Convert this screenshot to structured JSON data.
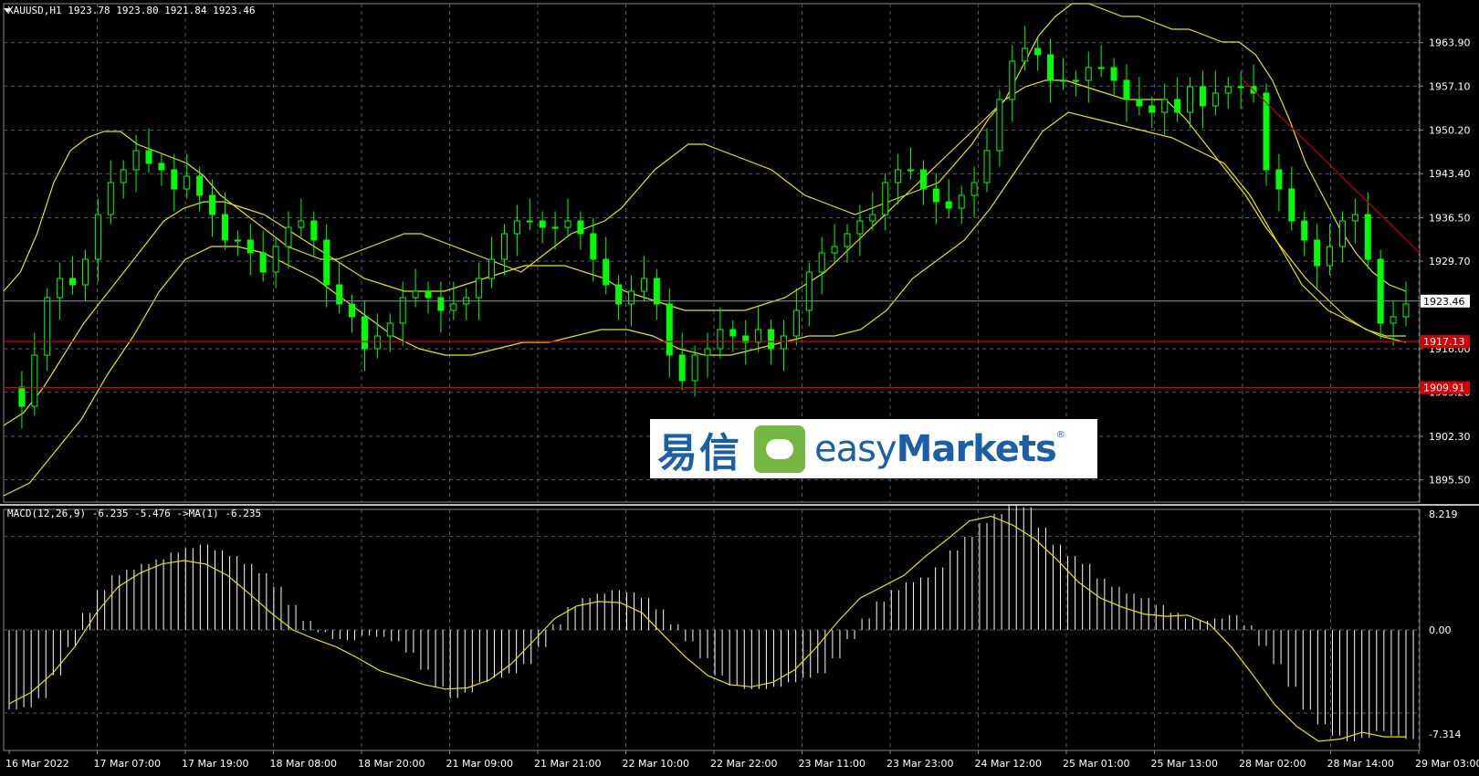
{
  "window": {
    "symbol_header": "XAUUSD,H1  1923.78 1923.80 1921.84 1923.46"
  },
  "indicator": {
    "macd_header": "MACD(12,26,9) -6.235 -5.476  ->MA(1) -6.235"
  },
  "price_axis": {
    "ticks": [
      "1963.90",
      "1957.10",
      "1950.20",
      "1943.40",
      "1936.50",
      "1929.70",
      "1923.46",
      "1916.00",
      "1909.20",
      "1902.30",
      "1895.50"
    ],
    "current_price": "1923.46",
    "level_1": "1917.13",
    "level_2": "1909.91"
  },
  "macd_axis": {
    "ticks": [
      "8.219",
      "0.00",
      "-7.314"
    ]
  },
  "time_axis": {
    "labels": [
      "16 Mar 2022",
      "17 Mar 07:00",
      "17 Mar 19:00",
      "18 Mar 08:00",
      "18 Mar 20:00",
      "21 Mar 09:00",
      "21 Mar 21:00",
      "22 Mar 10:00",
      "22 Mar 22:00",
      "23 Mar 11:00",
      "23 Mar 23:00",
      "24 Mar 12:00",
      "25 Mar 01:00",
      "25 Mar 13:00",
      "28 Mar 02:00",
      "28 Mar 14:00",
      "29 Mar 03:00"
    ]
  },
  "logo": {
    "cn": "易信",
    "en_light": "easy",
    "en_bold": "Markets",
    "reg": "®"
  },
  "colors": {
    "candle": "#00ff00",
    "bands": "#e6e600",
    "level": "#d40000",
    "trend": "#c00000",
    "grid": "#4d5a66"
  },
  "chart_data": [
    {
      "type": "candlestick",
      "title": "XAUUSD,H1",
      "ylim": [
        1892,
        1970
      ],
      "x_labels": [
        "16 Mar 2022",
        "17 Mar 07:00",
        "17 Mar 19:00",
        "18 Mar 08:00",
        "18 Mar 20:00",
        "21 Mar 09:00",
        "21 Mar 21:00",
        "22 Mar 10:00",
        "22 Mar 22:00",
        "23 Mar 11:00",
        "23 Mar 23:00",
        "24 Mar 12:00",
        "25 Mar 01:00",
        "25 Mar 13:00",
        "28 Mar 02:00",
        "28 Mar 14:00",
        "29 Mar 03:00"
      ],
      "close_series": [
        1910,
        1907,
        1915,
        1924,
        1927,
        1926,
        1930,
        1937,
        1942,
        1944,
        1947,
        1945,
        1944,
        1941,
        1943,
        1940,
        1937,
        1933,
        1933,
        1931,
        1928,
        1932,
        1935,
        1936,
        1933,
        1926,
        1923,
        1921,
        1916,
        1918,
        1920,
        1924,
        1925,
        1924,
        1922,
        1923,
        1924,
        1927,
        1930,
        1934,
        1936,
        1936,
        1935,
        1935,
        1936,
        1934,
        1930,
        1926,
        1923,
        1925,
        1927,
        1923,
        1915,
        1911,
        1915,
        1916,
        1919,
        1918,
        1917,
        1919,
        1916,
        1918,
        1922,
        1928,
        1931,
        1932,
        1934,
        1936,
        1937,
        1942,
        1944,
        1944,
        1941,
        1939,
        1938,
        1940,
        1942,
        1947,
        1955,
        1961,
        1963,
        1962,
        1958,
        1958,
        1958,
        1960,
        1960,
        1958,
        1955,
        1954,
        1953,
        1955,
        1953,
        1957,
        1954,
        1956,
        1957,
        1957,
        1956,
        1944,
        1941,
        1936,
        1933,
        1929,
        1932,
        1936,
        1937,
        1930,
        1920,
        1921,
        1923
      ],
      "upper_band": [
        1925,
        1928,
        1934,
        1942,
        1947,
        1949,
        1950,
        1950,
        1948,
        1947,
        1946,
        1945,
        1943,
        1940,
        1938,
        1936,
        1934,
        1932,
        1931,
        1930,
        1930,
        1931,
        1932,
        1933,
        1934,
        1934,
        1933,
        1932,
        1931,
        1930,
        1929,
        1928,
        1930,
        1932,
        1934,
        1935,
        1936,
        1938,
        1941,
        1944,
        1946,
        1948,
        1948,
        1947,
        1946,
        1945,
        1944,
        1942,
        1940,
        1939,
        1938,
        1937,
        1938,
        1939,
        1940,
        1941,
        1942,
        1945,
        1948,
        1952,
        1955,
        1960,
        1965,
        1968,
        1970,
        1970,
        1969,
        1968,
        1968,
        1967,
        1966,
        1966,
        1965,
        1964,
        1964,
        1962,
        1958,
        1952,
        1945,
        1940,
        1935,
        1931,
        1928,
        1926,
        1925
      ],
      "middle_band": [
        1904,
        1906,
        1910,
        1915,
        1920,
        1924,
        1928,
        1932,
        1936,
        1938,
        1939,
        1939,
        1938,
        1937,
        1935,
        1933,
        1931,
        1929,
        1927,
        1926,
        1925,
        1925,
        1925,
        1926,
        1927,
        1928,
        1929,
        1929,
        1929,
        1928,
        1927,
        1925,
        1924,
        1923,
        1922,
        1922,
        1922,
        1922,
        1923,
        1924,
        1926,
        1928,
        1931,
        1934,
        1937,
        1940,
        1943,
        1946,
        1949,
        1952,
        1955,
        1957,
        1958,
        1958,
        1957,
        1956,
        1955,
        1955,
        1955,
        1952,
        1948,
        1944,
        1940,
        1935,
        1931,
        1927,
        1924,
        1921,
        1919,
        1918,
        1918
      ],
      "lower_band": [
        1893,
        1895,
        1900,
        1905,
        1912,
        1918,
        1925,
        1930,
        1932,
        1932,
        1931,
        1929,
        1927,
        1924,
        1921,
        1918,
        1916,
        1915,
        1915,
        1916,
        1917,
        1917,
        1918,
        1919,
        1919,
        1918,
        1916,
        1915,
        1915,
        1916,
        1917,
        1918,
        1918,
        1919,
        1922,
        1927,
        1930,
        1933,
        1938,
        1944,
        1950,
        1953,
        1952,
        1951,
        1950,
        1949,
        1947,
        1945,
        1940,
        1933,
        1926,
        1922,
        1920,
        1918,
        1917
      ],
      "horizontal_levels": [
        1917.13,
        1909.91
      ],
      "trendline": [
        {
          "x": 0.85,
          "y": 1958.0
        },
        {
          "x": 1.0,
          "y": 1931.0
        }
      ]
    },
    {
      "type": "bar",
      "title": "MACD(12,26,9)",
      "ylim": [
        -7.314,
        8.219
      ],
      "values": [
        -7.0,
        -6.8,
        -6.0,
        -4.0,
        -1.5,
        1.5,
        3.5,
        4.8,
        5.3,
        5.8,
        6.2,
        6.8,
        7.2,
        7.5,
        7.0,
        6.5,
        5.8,
        5.0,
        3.8,
        2.2,
        0.8,
        -0.2,
        -0.8,
        -0.9,
        -0.5,
        -0.6,
        -1.0,
        -2.0,
        -3.5,
        -5.0,
        -6.0,
        -5.5,
        -4.6,
        -4.2,
        -3.8,
        -3.0,
        -1.5,
        0.5,
        2.0,
        2.8,
        3.2,
        3.5,
        3.3,
        2.8,
        1.8,
        0.5,
        -1.0,
        -2.5,
        -4.0,
        -4.9,
        -5.2,
        -5.2,
        -5.0,
        -4.6,
        -4.2,
        -3.8,
        -2.5,
        -0.8,
        1.0,
        2.5,
        3.5,
        4.2,
        4.6,
        5.5,
        7.0,
        8.2,
        9.4,
        10.2,
        11.0,
        10.8,
        9.0,
        7.5,
        6.5,
        5.8,
        4.5,
        3.8,
        3.2,
        2.8,
        2.2,
        1.5,
        1.0,
        0.8,
        1.0,
        1.3,
        0.4,
        -1.4,
        -3.0,
        -5.0,
        -7.0,
        -8.3,
        -9.3,
        -9.8,
        -9.5,
        -8.9,
        -9.3,
        -9.6
      ],
      "signal": [
        -6.5,
        -5.5,
        -3.8,
        -1.5,
        1.5,
        3.8,
        5.0,
        5.8,
        6.1,
        5.8,
        4.8,
        3.2,
        1.5,
        0.0,
        -0.8,
        -1.5,
        -2.5,
        -3.6,
        -4.2,
        -4.8,
        -5.2,
        -5.1,
        -4.4,
        -3.0,
        -1.0,
        1.0,
        2.1,
        2.5,
        2.4,
        1.5,
        -0.5,
        -2.4,
        -4.0,
        -4.8,
        -5.0,
        -4.6,
        -3.5,
        -1.5,
        0.8,
        2.8,
        3.8,
        4.8,
        6.5,
        8.0,
        9.6,
        10.0,
        9.2,
        8.0,
        6.2,
        4.2,
        2.8,
        2.0,
        1.4,
        1.2,
        1.3,
        0.5,
        -1.5,
        -4.0,
        -6.6,
        -8.5,
        -9.8,
        -9.6,
        -9.0,
        -9.4,
        -9.4
      ]
    }
  ]
}
